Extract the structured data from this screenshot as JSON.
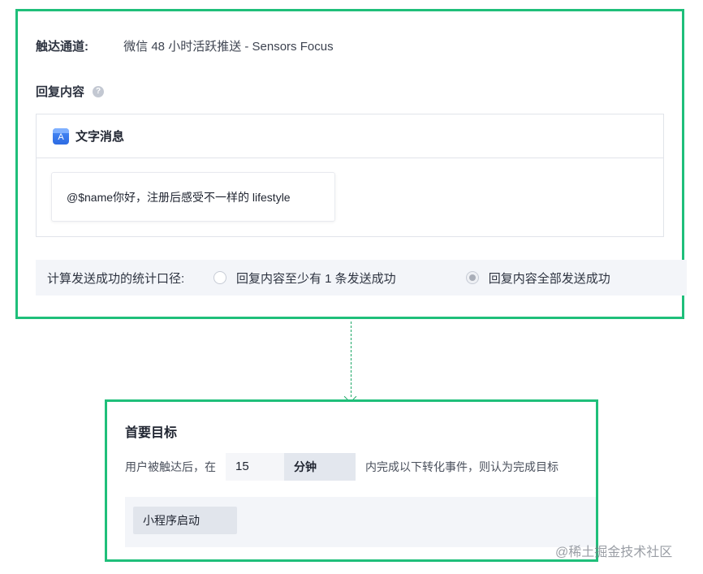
{
  "channel": {
    "label": "触达通道:",
    "value": "微信 48 小时活跃推送 - Sensors Focus"
  },
  "reply": {
    "title": "回复内容",
    "help_icon": "?"
  },
  "message_panel": {
    "app_icon": "A",
    "title": "文字消息",
    "text": "@$name你好，注册后感受不一样的 lifestyle"
  },
  "stat": {
    "label": "计算发送成功的统计口径:",
    "options": [
      {
        "label": "回复内容至少有 1 条发送成功",
        "checked": false
      },
      {
        "label": "回复内容全部发送成功",
        "checked": true
      }
    ]
  },
  "goal": {
    "title": "首要目标",
    "prefix": "用户被触达后，在",
    "value": "15",
    "unit": "分钟",
    "suffix": "内完成以下转化事件，则认为完成目标",
    "event": "小程序启动"
  },
  "watermark": "@稀土掘金技术社区",
  "colors": {
    "highlight_border": "#1fbf7a",
    "connector": "#1fa868"
  }
}
